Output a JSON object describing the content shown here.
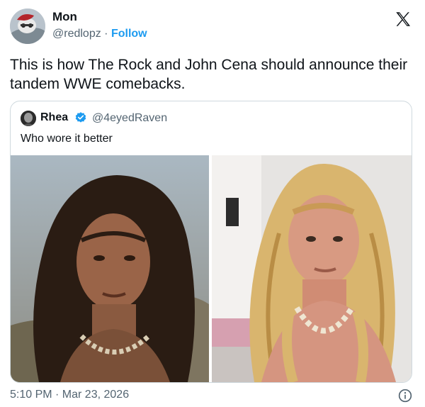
{
  "author": {
    "name": "Mon",
    "handle": "@redlopz",
    "separator": "·",
    "follow_label": "Follow"
  },
  "tweet": {
    "text": "This is how The Rock and John Cena should announce their tandem WWE comebacks."
  },
  "quoted": {
    "name": "Rhea",
    "handle": "@4eyedRaven",
    "text": "Who wore it better",
    "verified": true,
    "images": [
      {
        "icon": "photo-long-dark-hair"
      },
      {
        "icon": "photo-long-blonde-hair"
      }
    ]
  },
  "footer": {
    "timestamp": "5:10 PM · Mar 23, 2026"
  },
  "colors": {
    "accent": "#1d9bf0",
    "secondary_text": "#536471",
    "border": "#cfd9de"
  }
}
